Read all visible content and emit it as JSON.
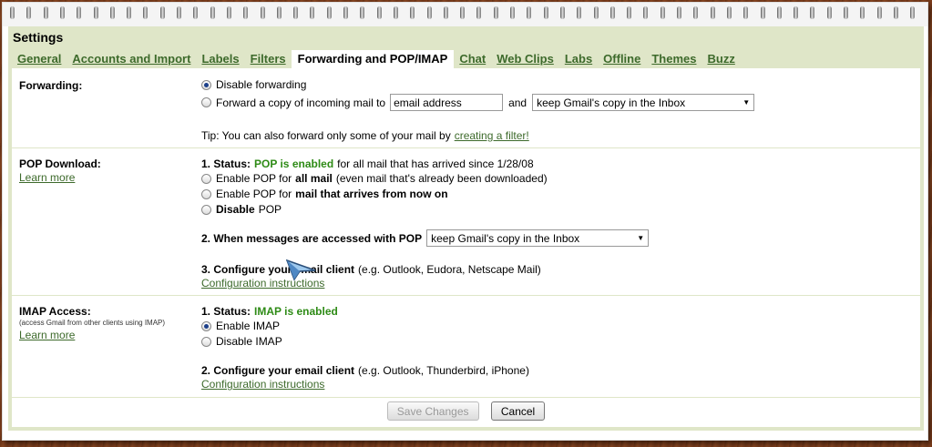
{
  "header": {
    "title": "Settings",
    "tabs": [
      {
        "label": "General",
        "active": false
      },
      {
        "label": "Accounts and Import",
        "active": false
      },
      {
        "label": "Labels",
        "active": false
      },
      {
        "label": "Filters",
        "active": false
      },
      {
        "label": "Forwarding and POP/IMAP",
        "active": true
      },
      {
        "label": "Chat",
        "active": false
      },
      {
        "label": "Web Clips",
        "active": false
      },
      {
        "label": "Labs",
        "active": false
      },
      {
        "label": "Offline",
        "active": false
      },
      {
        "label": "Themes",
        "active": false
      },
      {
        "label": "Buzz",
        "active": false
      }
    ]
  },
  "forwarding": {
    "label": "Forwarding:",
    "disable_option": "Disable forwarding",
    "forward_option": "Forward a copy of incoming mail to",
    "email_value": "email address",
    "and_text": "and",
    "copy_select": "keep Gmail's copy in the Inbox",
    "tip_text": "Tip: You can also forward only some of your mail by",
    "tip_link": "creating a filter!"
  },
  "pop": {
    "label": "POP Download:",
    "learn_more": "Learn more",
    "status_prefix": "1. Status:",
    "status_value": "POP is enabled",
    "status_suffix": "for all mail that has arrived since 1/28/08",
    "opt_all_prefix": "Enable POP for",
    "opt_all_bold": "all mail",
    "opt_all_suffix": "(even mail that's already been downloaded)",
    "opt_now_prefix": "Enable POP for",
    "opt_now_bold": "mail that arrives from now on",
    "opt_disable_bold": "Disable",
    "opt_disable_suffix": "POP",
    "step2": "2. When messages are accessed with POP",
    "step2_select": "keep Gmail's copy in the Inbox",
    "step3": "3. Configure your email client",
    "step3_hint": "(e.g. Outlook, Eudora, Netscape Mail)",
    "config_link": "Configuration instructions"
  },
  "imap": {
    "label": "IMAP Access:",
    "sublabel": "(access Gmail from other clients using IMAP)",
    "learn_more": "Learn more",
    "status_prefix": "1. Status:",
    "status_value": "IMAP is enabled",
    "enable_option": "Enable IMAP",
    "disable_option": "Disable IMAP",
    "step2": "2. Configure your email client",
    "step2_hint": "(e.g. Outlook, Thunderbird, iPhone)",
    "config_link": "Configuration instructions"
  },
  "buttons": {
    "save": "Save Changes",
    "cancel": "Cancel"
  },
  "icons": {
    "cursor": "pointer-arrow-icon"
  }
}
